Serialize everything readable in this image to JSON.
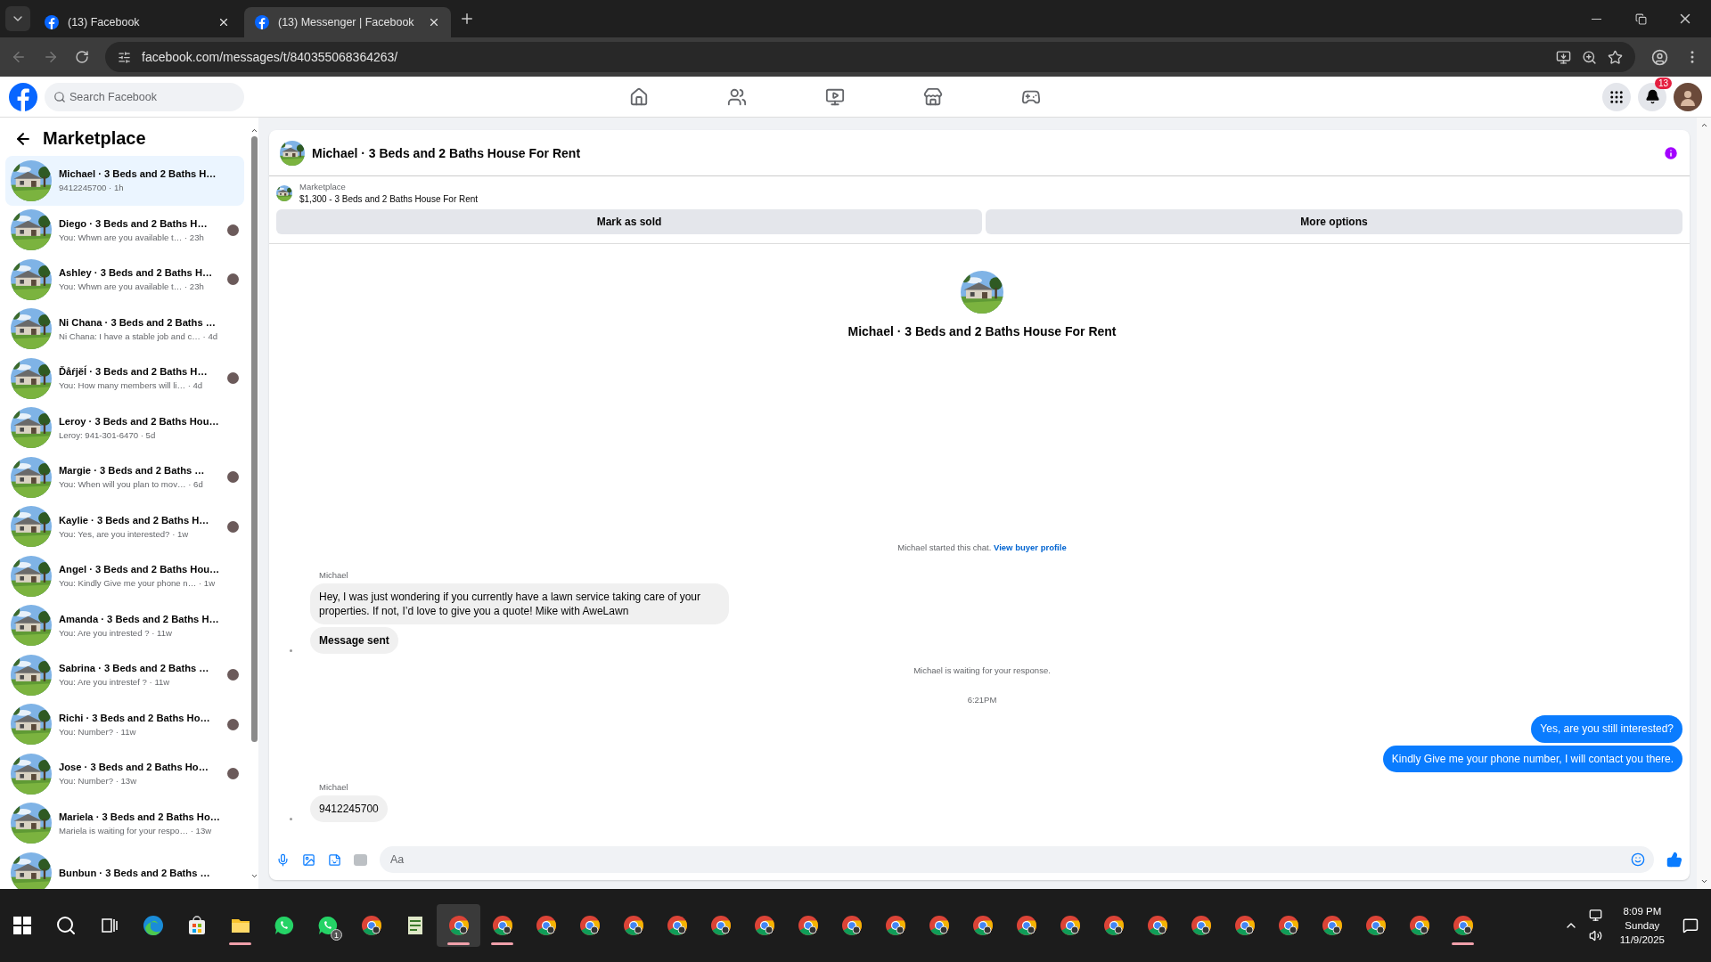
{
  "browser": {
    "tabs": [
      {
        "title": "(13) Facebook",
        "selected": false
      },
      {
        "title": "(13) Messenger | Facebook",
        "selected": true
      }
    ],
    "url": "facebook.com/messages/t/840355068364263/"
  },
  "header": {
    "search": {
      "placeholder": "Search Facebook"
    },
    "nav": [
      {
        "kind": "home"
      },
      {
        "kind": "friends"
      },
      {
        "kind": "video"
      },
      {
        "kind": "marketplace"
      },
      {
        "kind": "gaming"
      }
    ],
    "notification_badge": "13"
  },
  "sidebar": {
    "title": "Marketplace",
    "items": [
      {
        "title": "Michael · 3 Beds and 2 Baths H…",
        "preview": "9412245700",
        "time": "· 1h",
        "seen": false,
        "selected": true
      },
      {
        "title": "Diego · 3 Beds and 2 Baths H…",
        "preview": "You: Whwn are you available t…",
        "time": "· 23h",
        "seen": true,
        "selected": false
      },
      {
        "title": "Ashley · 3 Beds and 2 Baths H…",
        "preview": "You: Whwn are you available t…",
        "time": "· 23h",
        "seen": true,
        "selected": false
      },
      {
        "title": "Ni Chana · 3 Beds and 2 Baths …",
        "preview": "Ni Chana: I have a stable job and c…",
        "time": "· 4d",
        "seen": false,
        "selected": false
      },
      {
        "title": "Ďåŕjěĺ · 3 Beds and 2 Baths H…",
        "preview": "You: How many members will li…",
        "time": "· 4d",
        "seen": true,
        "selected": false
      },
      {
        "title": "Leroy · 3 Beds and 2 Baths Hou…",
        "preview": "Leroy: 941-301-6470",
        "time": "· 5d",
        "seen": false,
        "selected": false
      },
      {
        "title": "Margie · 3 Beds and 2 Baths …",
        "preview": "You: When will you plan to mov…",
        "time": "· 6d",
        "seen": true,
        "selected": false
      },
      {
        "title": "Kaylie · 3 Beds and 2 Baths H…",
        "preview": "You: Yes, are you interested?",
        "time": "· 1w",
        "seen": true,
        "selected": false
      },
      {
        "title": "Angel · 3 Beds and 2 Baths Hou…",
        "preview": "You: Kindly Give me your phone n…",
        "time": "· 1w",
        "seen": false,
        "selected": false
      },
      {
        "title": "Amanda · 3 Beds and 2 Baths H…",
        "preview": "You: Are you intrested ?",
        "time": "· 11w",
        "seen": false,
        "selected": false
      },
      {
        "title": "Sabrina · 3 Beds and 2 Baths …",
        "preview": "You: Are you intrestef ?",
        "time": "· 11w",
        "seen": true,
        "selected": false
      },
      {
        "title": "Richi · 3 Beds and 2 Baths Ho…",
        "preview": "You: Number?",
        "time": "· 11w",
        "seen": true,
        "selected": false
      },
      {
        "title": "Jose · 3 Beds and 2 Baths Ho…",
        "preview": "You: Number?",
        "time": "· 13w",
        "seen": true,
        "selected": false
      },
      {
        "title": "Mariela · 3 Beds and 2 Baths Ho…",
        "preview": "Mariela is waiting for your respo…",
        "time": "· 13w",
        "seen": false,
        "selected": false
      },
      {
        "title": "Bunbun · 3 Beds and 2 Baths …",
        "selected": false
      }
    ]
  },
  "chat": {
    "title": "Michael · 3 Beds and 2 Baths House For Rent",
    "listing": {
      "label": "Marketplace",
      "description": "$1,300 - 3 Beds and 2 Baths House For Rent"
    },
    "actions": [
      "Mark as sold",
      "More options"
    ],
    "profile_title": "Michael · 3 Beds and 2 Baths House For Rent",
    "messages": [
      {
        "kind": "system",
        "text": "Michael started this chat.",
        "link": "View buyer profile"
      },
      {
        "kind": "sender",
        "text": "Michael"
      },
      {
        "kind": "incoming",
        "text": "Hey, I was just wondering if you currently have a lawn service taking care of your properties. If not, I’d love to give you a quote! Mike with AweLawn",
        "last": false
      },
      {
        "kind": "incoming-bold",
        "text": "Message sent",
        "last": true
      },
      {
        "kind": "system",
        "text": "Michael is waiting for your response."
      },
      {
        "kind": "time",
        "text": "6:21PM"
      },
      {
        "kind": "outgoing",
        "text": "Yes, are you still interested?"
      },
      {
        "kind": "outgoing",
        "text": "Kindly Give me your phone number, I will contact you there."
      },
      {
        "kind": "sender",
        "text": "Michael"
      },
      {
        "kind": "incoming",
        "text": "9412245700",
        "last": true
      }
    ],
    "composer": {
      "placeholder": "Aa"
    }
  },
  "taskbar": {
    "start_buttons": [
      {
        "kind": "start"
      },
      {
        "kind": "search"
      },
      {
        "kind": "taskview"
      }
    ],
    "apps": [
      {
        "kind": "edge",
        "running": false
      },
      {
        "kind": "store",
        "running": false
      },
      {
        "kind": "files",
        "running": true
      },
      {
        "kind": "whatsapp",
        "running": false
      },
      {
        "kind": "whatsapp",
        "running": false,
        "badge": "1"
      },
      {
        "kind": "chrome",
        "running": false
      },
      {
        "kind": "notes",
        "running": false
      },
      {
        "kind": "chrome",
        "running": true,
        "active": true
      },
      {
        "kind": "chrome",
        "running": true
      },
      {
        "kind": "chrome",
        "running": false
      },
      {
        "kind": "chrome",
        "running": false
      },
      {
        "kind": "chrome",
        "running": false
      },
      {
        "kind": "chrome",
        "running": false
      },
      {
        "kind": "chrome",
        "running": false
      },
      {
        "kind": "chrome",
        "running": false
      },
      {
        "kind": "chrome",
        "running": false
      },
      {
        "kind": "chrome",
        "running": false
      },
      {
        "kind": "chrome",
        "running": false
      },
      {
        "kind": "chrome",
        "running": false
      },
      {
        "kind": "chrome",
        "running": false
      },
      {
        "kind": "chrome",
        "running": false
      },
      {
        "kind": "chrome",
        "running": false
      },
      {
        "kind": "chrome",
        "running": false
      },
      {
        "kind": "chrome",
        "running": false
      },
      {
        "kind": "chrome",
        "running": false
      },
      {
        "kind": "chrome",
        "running": false
      },
      {
        "kind": "chrome",
        "running": false
      },
      {
        "kind": "chrome",
        "running": false
      },
      {
        "kind": "chrome",
        "running": false
      },
      {
        "kind": "chrome",
        "running": false
      },
      {
        "kind": "chrome",
        "running": true
      }
    ],
    "time": "8:09 PM",
    "day": "Sunday",
    "date": "11/9/2025"
  }
}
